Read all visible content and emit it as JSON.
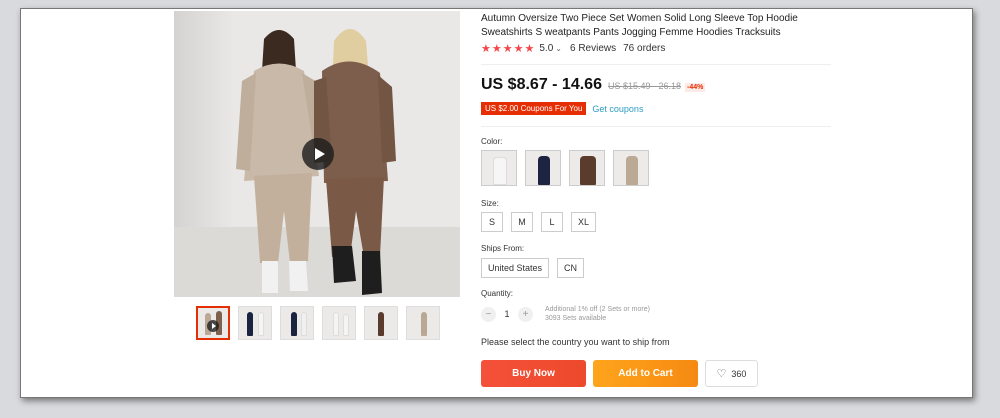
{
  "product": {
    "title": "Autumn Oversize Two Piece Set Women Solid Long Sleeve Top Hoodie Sweatshirts S weatpants Pants Jogging Femme Hoodies Tracksuits",
    "rating": "5.0",
    "rating_max": 5,
    "reviews": "6 Reviews",
    "orders": "76 orders",
    "price": "US $8.67 - 14.66",
    "original_price": "US $15.49 - 26.18",
    "discount": "-44%",
    "coupon": "US $2.00 Coupons For You",
    "get_coupons": "Get coupons"
  },
  "colors": {
    "star": "#f5474a",
    "accent_red": "#e62e04",
    "buy": "#ee4d2d",
    "cart": "#f7931e",
    "link": "#2e9cc3"
  },
  "color_option": {
    "label": "Color:",
    "swatches": [
      "white",
      "navy",
      "brown",
      "beige"
    ]
  },
  "size_option": {
    "label": "Size:",
    "values": [
      "S",
      "M",
      "L",
      "XL"
    ]
  },
  "ships_from": {
    "label": "Ships From:",
    "values": [
      "United States",
      "CN"
    ]
  },
  "quantity": {
    "label": "Quantity:",
    "minus": "−",
    "value": "1",
    "plus": "+",
    "note_1": "Additional 1% off (2 Sets or more)",
    "note_2": "3093 Sets available"
  },
  "ship_message": "Please select the country you want to ship from",
  "actions": {
    "buy_now": "Buy Now",
    "add_to_cart": "Add to Cart",
    "wishlist_count": "360"
  },
  "gallery": {
    "thumbnails": [
      "beige-pair-video",
      "white-front",
      "navy-front",
      "white-side",
      "brown-front",
      "beige-front"
    ]
  }
}
